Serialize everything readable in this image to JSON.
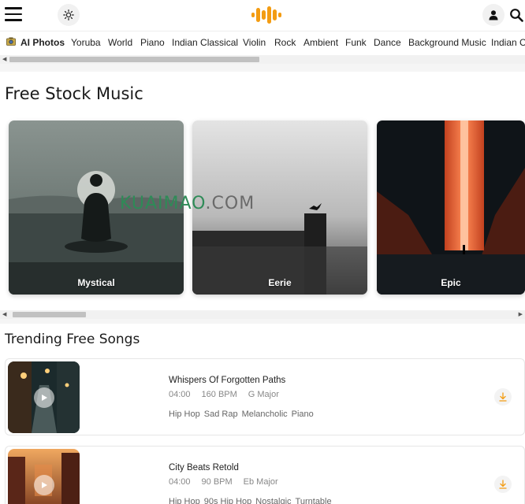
{
  "header": {
    "menu_icon": "hamburger-icon",
    "theme_icon": "sun-icon",
    "logo_icon": "sound-wave-logo",
    "user_icon": "user-icon",
    "search_icon": "search-icon",
    "brand_color": "#F39C12"
  },
  "categories": [
    "AI Photos",
    "Yoruba",
    "World",
    "Piano",
    "Indian Classical",
    "Violin",
    "Rock",
    "Ambient",
    "Funk",
    "Dance",
    "Background Music",
    "Indian C"
  ],
  "stock_section": {
    "title": "Free Stock Music",
    "cards": [
      {
        "label": "Mystical"
      },
      {
        "label": "Eerie"
      },
      {
        "label": "Epic"
      }
    ]
  },
  "watermark": {
    "part1": "KUAIMAO",
    "part2": ".COM"
  },
  "trending_section": {
    "title": "Trending Free Songs",
    "songs": [
      {
        "title": "Whispers Of Forgotten Paths",
        "duration": "04:00",
        "bpm": "160 BPM",
        "key": "G Major",
        "tags": [
          "Hip Hop",
          "Sad Rap",
          "Melancholic",
          "Piano"
        ]
      },
      {
        "title": "City Beats Retold",
        "duration": "04:00",
        "bpm": "90 BPM",
        "key": "Eb Major",
        "tags": [
          "Hip Hop",
          "90s Hip Hop",
          "Nostalgic",
          "Turntable"
        ]
      }
    ]
  }
}
